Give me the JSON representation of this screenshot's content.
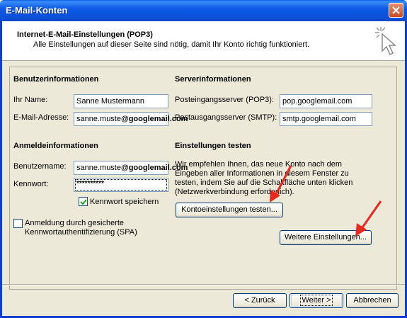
{
  "window": {
    "title": "E-Mail-Konten"
  },
  "header": {
    "title": "Internet-E-Mail-Einstellungen (POP3)",
    "subtitle": "Alle Einstellungen auf dieser Seite sind nötig, damit Ihr Konto richtig funktioniert."
  },
  "user_info": {
    "heading": "Benutzerinformationen",
    "name_label": "Ihr Name:",
    "name_value": "Sanne Mustermann",
    "email_label": "E-Mail-Adresse:",
    "email_value_prefix": "sanne.muste",
    "email_value_suffix": "@googlemail.com"
  },
  "server_info": {
    "heading": "Serverinformationen",
    "incoming_label": "Posteingangsserver (POP3):",
    "incoming_value": "pop.googlemail.com",
    "outgoing_label": "Postausgangsserver (SMTP):",
    "outgoing_value": "smtp.googlemail.com"
  },
  "login_info": {
    "heading": "Anmeldeinformationen",
    "user_label": "Benutzername:",
    "user_value_prefix": "sanne.muste",
    "user_value_suffix": "@googlemail.com",
    "password_label": "Kennwort:",
    "password_value": "**********",
    "remember_label": "Kennwort speichern",
    "remember_checked": true,
    "spa_label_line1": "Anmeldung durch gesicherte",
    "spa_label_line2": "Kennwortauthentifizierung (SPA)",
    "spa_checked": false
  },
  "test_settings": {
    "heading": "Einstellungen testen",
    "description": "Wir empfehlen Ihnen, das neue Konto nach dem Eingeben aller Informationen in diesem Fenster zu testen, indem Sie auf die Schaltfläche unten klicken (Netzwerkverbindung erforderlich).",
    "test_button": "Kontoeinstellungen testen...",
    "more_button": "Weitere Einstellungen..."
  },
  "footer": {
    "back_button": "< Zurück",
    "next_button": "Weiter >",
    "cancel_button": "Abbrechen"
  },
  "colors": {
    "annotation_arrow": "#e8281e",
    "titlebar": "#0a4ed6"
  },
  "icons": [
    "close-icon",
    "cursor-sparkle-icon",
    "checkmark-icon",
    "red-arrow-annotation"
  ]
}
